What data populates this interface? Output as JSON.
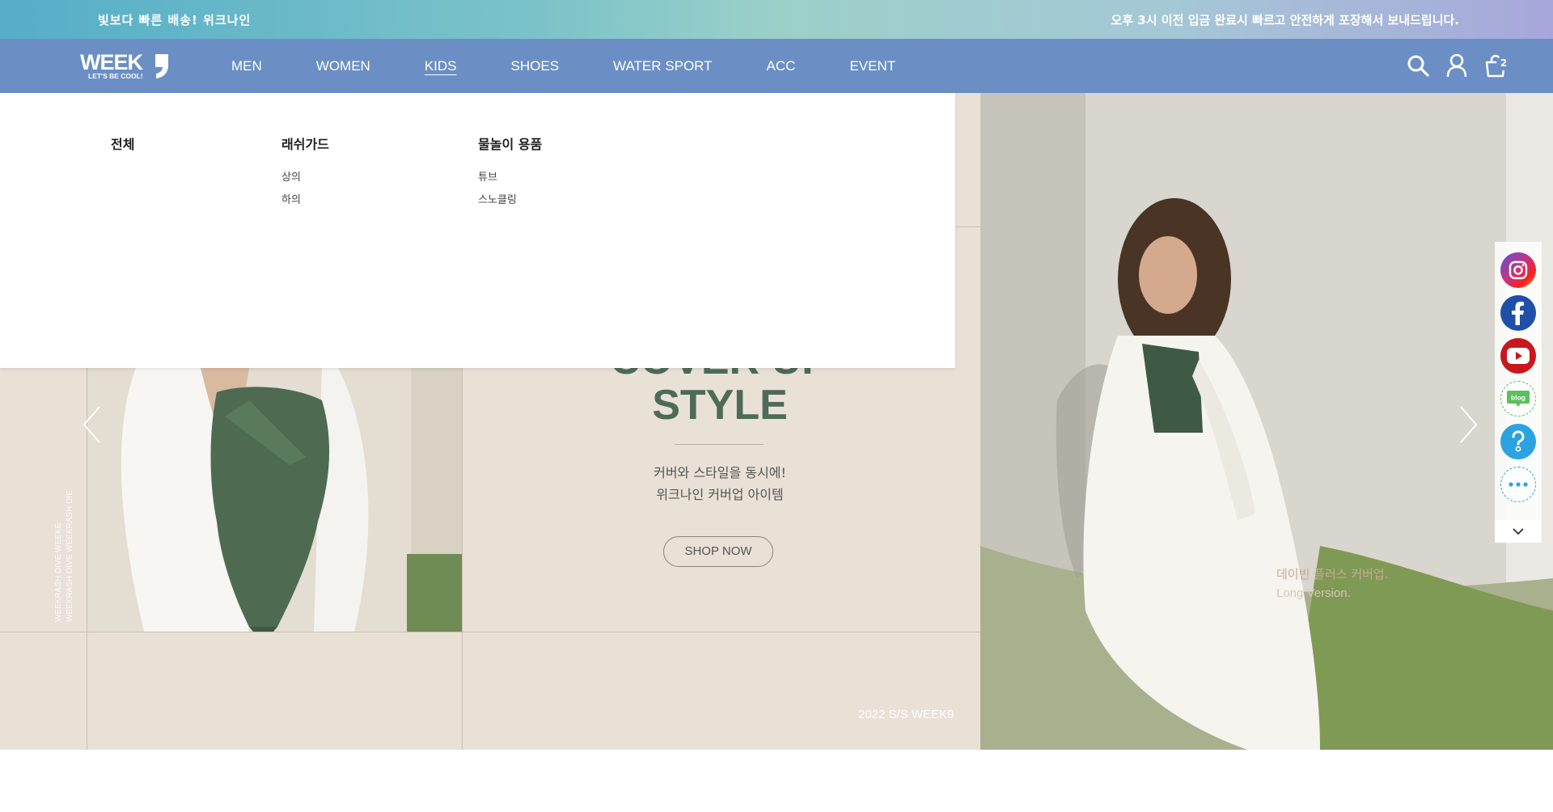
{
  "topbar": {
    "left_text": "빛보다 빠른 배송! 위크나인",
    "right_text": "오후 3시 이전 입금 완료시 빠르고 안전하게 포장해서 보내드립니다."
  },
  "header": {
    "logo_text": "WEEK9",
    "logo_slogan": "LET'S BE COOL!",
    "nav": [
      {
        "label": "MEN"
      },
      {
        "label": "WOMEN"
      },
      {
        "label": "KIDS"
      },
      {
        "label": "SHOES"
      },
      {
        "label": "WATER SPORT"
      },
      {
        "label": "ACC"
      },
      {
        "label": "EVENT"
      }
    ],
    "active_nav": "KIDS",
    "cart_count": "2",
    "icons": [
      "search-icon",
      "user-icon",
      "cart-icon"
    ]
  },
  "dropdown": {
    "col1": {
      "heading": "전체"
    },
    "col2": {
      "heading": "래쉬가드",
      "items": [
        "상의",
        "하의"
      ]
    },
    "col3": {
      "heading": "물놀이 용품",
      "items": [
        "튜브",
        "스노클링"
      ]
    }
  },
  "hero": {
    "title_line1": "COVER UP",
    "title_line2": "STYLE",
    "sub_line1": "커버와 스타일을 동시에!",
    "sub_line2": "위크나인 커버업 아이템",
    "button": "SHOP NOW",
    "season": "2022 S/S WEEK9",
    "caption_line1": "데이빈 플러스 커버업.",
    "caption_line2": "Long Version.",
    "vertical_text_1": "WEEKRASH DIVE WEEKE",
    "vertical_text_2": "WEEKRASH DIVE WEEKRASH DIE"
  },
  "sidebar": {
    "items": [
      "instagram-icon",
      "facebook-icon",
      "youtube-icon",
      "blog-icon",
      "help-icon",
      "more-icon"
    ]
  },
  "colors": {
    "header_bg": "#6b8fc4",
    "title_green": "#4d6b57",
    "hero_bg": "#e9e0d6"
  }
}
